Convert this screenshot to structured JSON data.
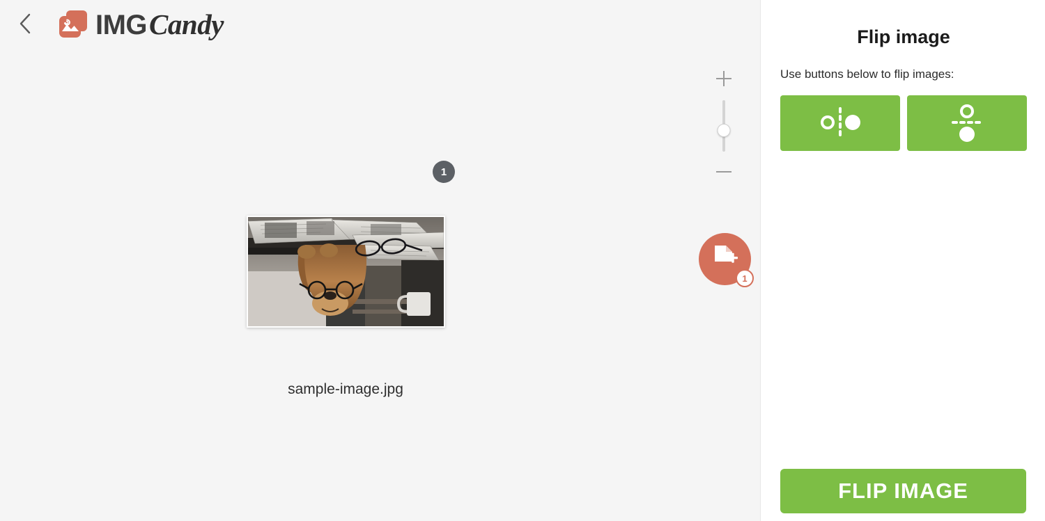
{
  "header": {
    "back_icon": "chevron-left-icon",
    "logo_icon": "imgcandy-photos-icon",
    "brand_primary": "IMG",
    "brand_secondary": "Candy"
  },
  "canvas": {
    "zoom": {
      "plus_icon": "plus-icon",
      "minus_icon": "minus-icon",
      "handle_label": "zoom-slider-handle"
    },
    "image": {
      "index_badge": "1",
      "filename": "sample-image.jpg",
      "alt": "upside-down photo of a dog wearing glasses on a desk with newspapers"
    },
    "upload": {
      "icon": "add-file-icon",
      "badge_count": "1"
    }
  },
  "panel": {
    "title": "Flip image",
    "subtitle": "Use buttons below to flip images:",
    "buttons": [
      {
        "name": "flip-horizontal-button",
        "icon": "flip-horizontal-icon"
      },
      {
        "name": "flip-vertical-button",
        "icon": "flip-vertical-icon"
      }
    ],
    "submit_label": "FLIP IMAGE"
  },
  "colors": {
    "green": "#7dbe45",
    "orange": "#d4705a",
    "canvas_bg": "#f5f5f5",
    "badge_gray": "#5c6065"
  }
}
